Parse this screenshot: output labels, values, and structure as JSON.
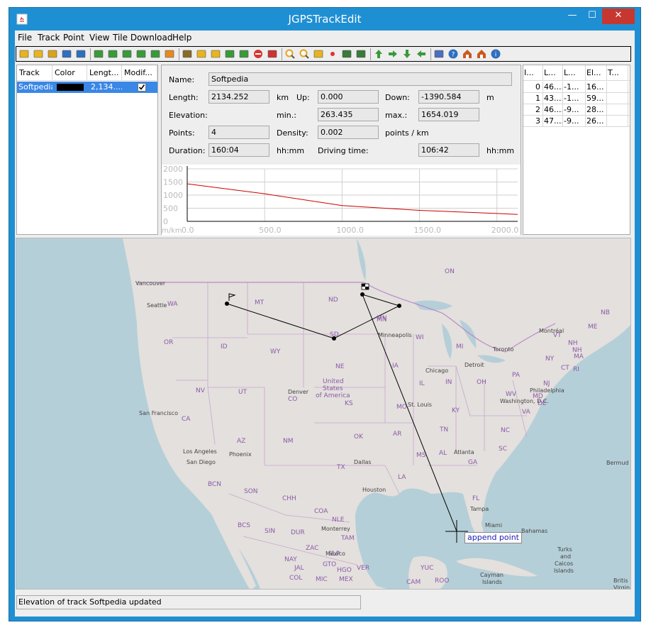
{
  "window": {
    "title": "JGPSTrackEdit"
  },
  "menu": [
    "File",
    "Track",
    "Point",
    "View",
    "Tile Download",
    "Help"
  ],
  "toolbar_icons": [
    "open-folder-icon",
    "open-multiple-icon",
    "open-file-icon",
    "save-icon",
    "save-all-icon",
    "select-track-icon",
    "refresh-icon",
    "merge-icon",
    "split-icon",
    "compress-icon",
    "correct-icon",
    "anchor-icon",
    "reverse-icon",
    "reverse-part-icon",
    "undo-icon",
    "add-point-icon",
    "delete-icon",
    "cut-icon",
    "zoom-in-icon",
    "zoom-out-icon",
    "fit-icon",
    "record-icon",
    "map-icon",
    "map-edit-icon",
    "arrow-up-icon",
    "arrow-right-icon",
    "arrow-down-icon",
    "arrow-left-icon",
    "tools-icon",
    "help-icon",
    "home-icon",
    "home-set-icon",
    "info-icon"
  ],
  "tracks_table": {
    "headers": [
      "Track",
      "Color",
      "Lengt...",
      "Modif..."
    ],
    "rows": [
      {
        "track": "Softpedia",
        "color": "#000000",
        "length": "2,134....",
        "modified": true
      }
    ]
  },
  "track_info": {
    "name_label": "Name:",
    "name_value": "Softpedia",
    "length_label": "Length:",
    "length_value": "2134.252",
    "length_unit": "km",
    "up_label": "Up:",
    "up_value": "0.000",
    "down_label": "Down:",
    "down_value": "-1390.584",
    "down_unit": "m",
    "elevation_label": "Elevation:",
    "min_label": "min.:",
    "min_value": "263.435",
    "max_label": "max.:",
    "max_value": "1654.019",
    "points_label": "Points:",
    "points_value": "4",
    "density_label": "Density:",
    "density_value": "0.002",
    "density_unit": "points / km",
    "duration_label": "Duration:",
    "duration_value": "160:04",
    "duration_unit": "hh:mm",
    "driving_label": "Driving time:",
    "driving_value": "106:42",
    "driving_unit": "hh:mm"
  },
  "chart_data": {
    "type": "line",
    "x": [
      0,
      500,
      1000,
      1500,
      2000,
      2134
    ],
    "series": [
      {
        "values": [
          1430,
          1050,
          600,
          420,
          300,
          263
        ],
        "color": "#cc0000"
      }
    ],
    "xlabel": "m/km",
    "x_ticks": [
      "0.0",
      "500.0",
      "1000.0",
      "1500.0",
      "2000.0"
    ],
    "y_ticks": [
      "2000",
      "1500",
      "1000",
      "500",
      "0"
    ],
    "xlim": [
      0,
      2134
    ],
    "ylim": [
      0,
      2000
    ],
    "grid": true
  },
  "points_table": {
    "headers": [
      "I...",
      "L...",
      "L...",
      "El...",
      "T..."
    ],
    "rows": [
      [
        "0",
        "46....",
        "-1...",
        "16...",
        ""
      ],
      [
        "1",
        "43....",
        "-1...",
        "59...",
        ""
      ],
      [
        "2",
        "46....",
        "-9...",
        "28...",
        ""
      ],
      [
        "3",
        "47....",
        "-9...",
        "26...",
        ""
      ]
    ]
  },
  "map": {
    "tooltip": "append point",
    "labels": {
      "on": "ON",
      "nb": "NB",
      "mt": "MT",
      "nd": "ND",
      "mn": "MN",
      "wa": "WA",
      "seattle": "Seattle",
      "vancouver": "Vancouver",
      "or": "OR",
      "id": "ID",
      "sd": "SD",
      "wy": "WY",
      "wi": "WI",
      "mi": "MI",
      "minneapolis": "Minneapolis",
      "ne": "NE",
      "ia": "IA",
      "us1": "United",
      "us2": "States",
      "us3": "of America",
      "nv": "NV",
      "ut": "UT",
      "denver": "Denver",
      "co": "CO",
      "ks": "KS",
      "mo": "MO",
      "il": "IL",
      "in": "IN",
      "oh": "OH",
      "pa": "PA",
      "ny": "NY",
      "vt": "VT",
      "nh": "NH",
      "me": "ME",
      "montreal": "Montréal",
      "toronto": "Toronto",
      "detroit": "Detroit",
      "chicago": "Chicago",
      "stlouis": "St. Louis",
      "ky": "KY",
      "wv": "WV",
      "va": "VA",
      "washington": "Washington, D.C.",
      "philadelphia": "Philadelphia",
      "nj": "NJ",
      "ct": "CT",
      "ma": "MA",
      "ri": "RI",
      "de": "DE",
      "md": "MD",
      "sanfrancisco": "San Francisco",
      "ca": "CA",
      "az": "AZ",
      "nm": "NM",
      "ok": "OK",
      "ar": "AR",
      "tn": "TN",
      "nc": "NC",
      "sc": "SC",
      "los_angeles": "Los Angeles",
      "sandiego": "San Diego",
      "phoenix": "Phoenix",
      "dallas": "Dallas",
      "tx": "TX",
      "la": "LA",
      "ms": "MS",
      "al": "AL",
      "atlanta": "Atlanta",
      "ga": "GA",
      "houston": "Houston",
      "fl": "FL",
      "tampa": "Tampa",
      "miami": "Miami",
      "bermuda": "Bermud",
      "bcn": "BCN",
      "son": "SON",
      "chh": "CHH",
      "coa": "COA",
      "nle": "NLE",
      "bcs": "BCS",
      "sin": "SIN",
      "dur": "DUR",
      "tam": "TAM",
      "monterrey": "Monterrey",
      "zac": "ZAC",
      "slp": "SLP",
      "mexico": "México",
      "nay": "NAY",
      "gto": "GTO",
      "hgo": "HGO",
      "jal": "JAL",
      "col": "COL",
      "mic": "MIC",
      "mex": "MEX",
      "ver": "VER",
      "yuc": "YUC",
      "cam": "CAM",
      "qr": "ROO",
      "bahamas": "Bahamas",
      "turks1": "Turks",
      "turks2": "and",
      "turks3": "Caicos",
      "turks4": "Islands",
      "cayman1": "Cayman",
      "cayman2": "Islands",
      "british1": "Britis",
      "british2": "Virgin",
      "nh2": "NH",
      "mn2": "MN"
    }
  },
  "status": {
    "message": "Elevation of track Softpedia updated"
  }
}
